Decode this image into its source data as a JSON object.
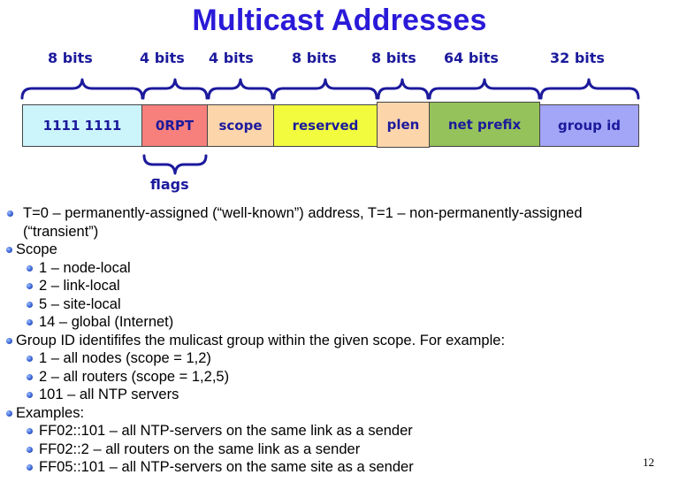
{
  "title": "Multicast Addresses",
  "bit_labels": [
    "8 bits",
    "4 bits",
    "4 bits",
    "8 bits",
    "8 bits",
    "64 bits",
    "32 bits"
  ],
  "fields": [
    {
      "label": "1111 1111",
      "color": "#ccf5fb"
    },
    {
      "label": "0RPT",
      "color": "#f7807c"
    },
    {
      "label": "scope",
      "color": "#fcd5aa"
    },
    {
      "label": "reserved",
      "color": "#f2fb3e"
    },
    {
      "label": "plen",
      "color": "#fcd5aa"
    },
    {
      "label": "net prefix",
      "color": "#95c25a"
    },
    {
      "label": "group id",
      "color": "#a3a5f7"
    }
  ],
  "flags_label": "flags",
  "bullets": [
    {
      "level": 1,
      "text": "T=0 – permanently-assigned (“well-known”) address, T=1 – non-permanently-assigned (“transient”)"
    },
    {
      "level": 1,
      "text": "Scope"
    },
    {
      "level": 2,
      "text": "1 – node-local"
    },
    {
      "level": 2,
      "text": "2 – link-local"
    },
    {
      "level": 2,
      "text": "5 – site-local"
    },
    {
      "level": 2,
      "text": "14 – global (Internet)"
    },
    {
      "level": 1,
      "text": "Group ID identififes the mulicast group within the given scope. For example:"
    },
    {
      "level": 2,
      "text": "1 – all nodes (scope = 1,2)"
    },
    {
      "level": 2,
      "text": "2 – all routers (scope = 1,2,5)"
    },
    {
      "level": 2,
      "text": "101 – all NTP servers"
    },
    {
      "level": 1,
      "text": "Examples:"
    },
    {
      "level": 2,
      "text": "FF02::101 – all NTP-servers on the same link as a sender"
    },
    {
      "level": 2,
      "text": "FF02::2 – all routers on the same link as a sender"
    },
    {
      "level": 2,
      "text": "FF05::101 – all NTP-servers on the same site as a sender"
    }
  ],
  "page_number": "12",
  "colors": {
    "title": "#2a1ad8",
    "label": "#1c1a9c",
    "brace": "#1c1a9c",
    "bullet": "#3a64d6"
  }
}
